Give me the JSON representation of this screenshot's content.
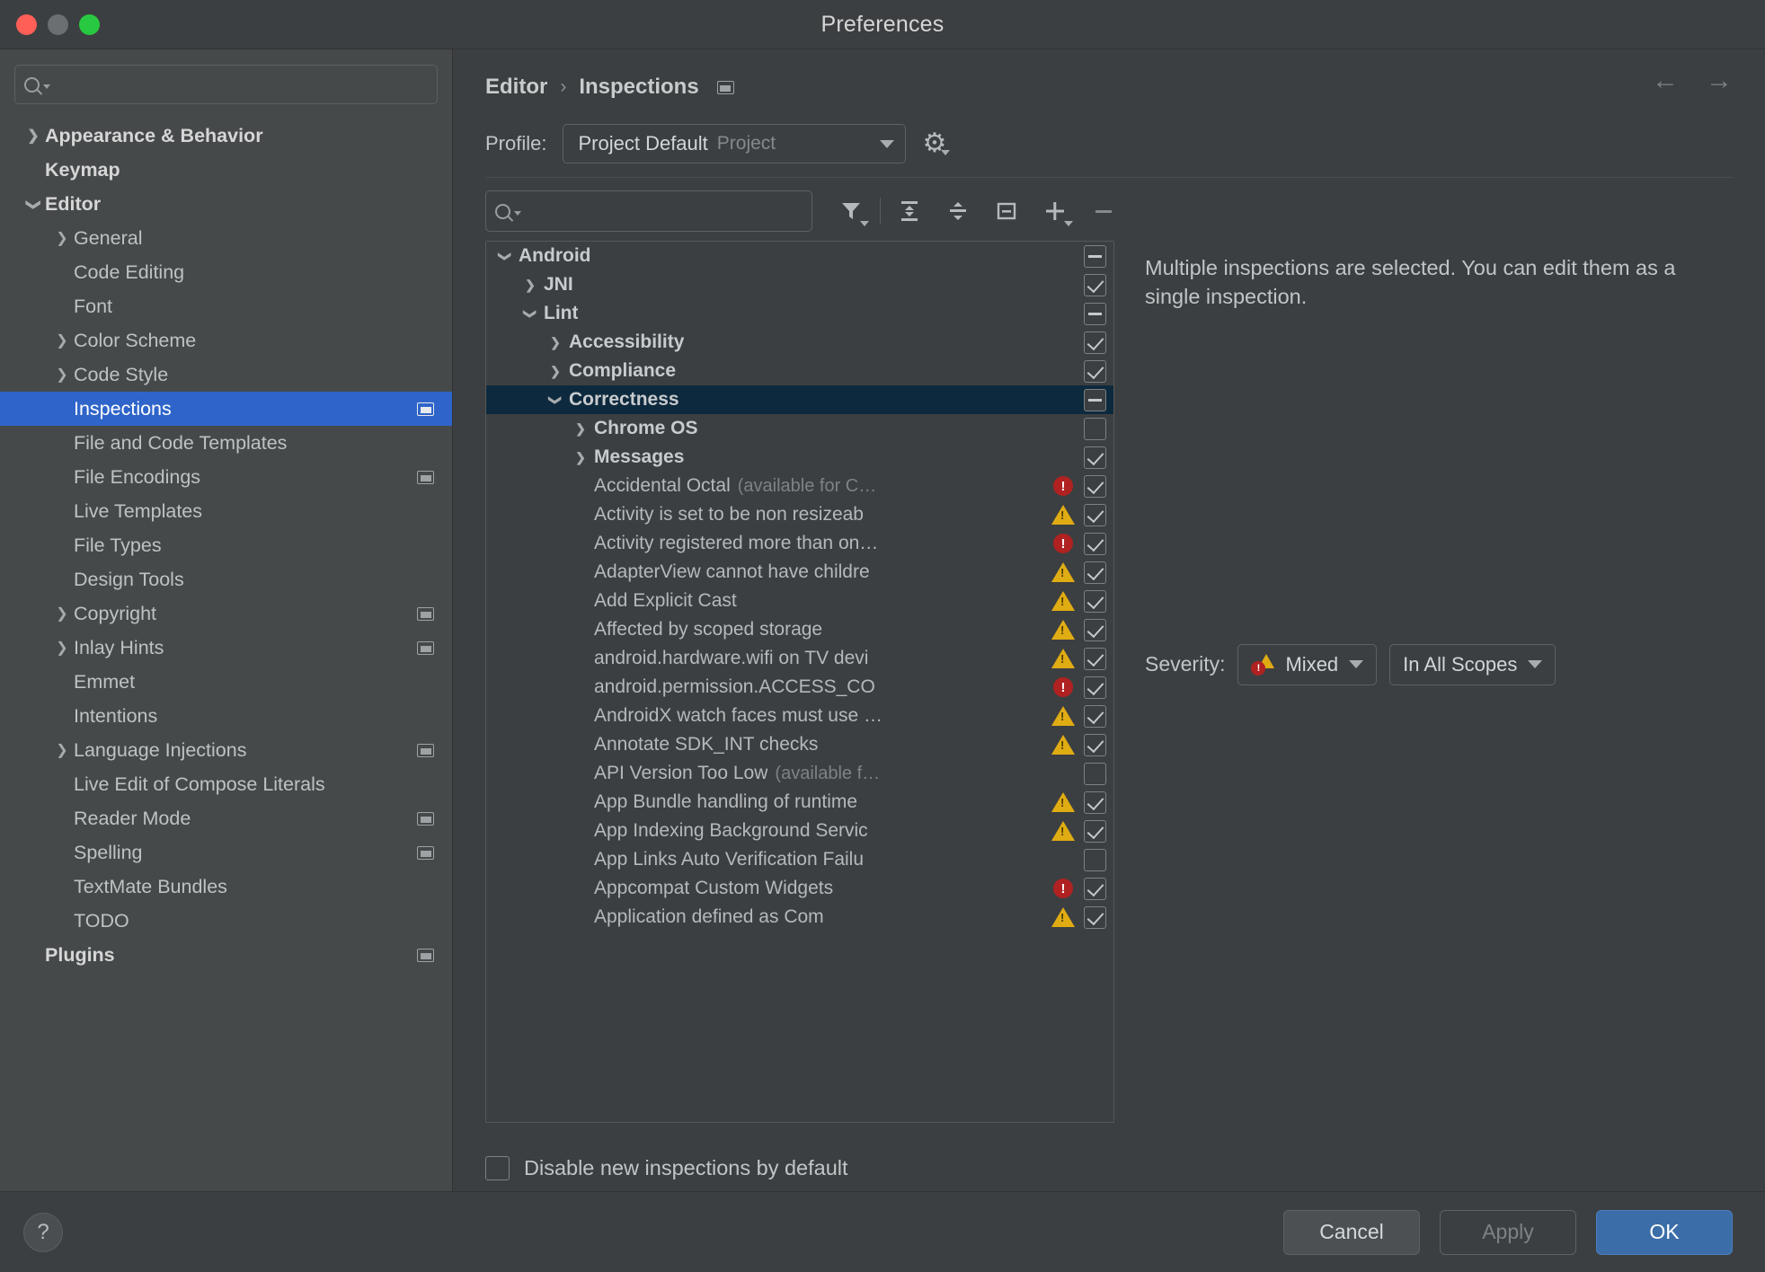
{
  "window": {
    "title": "Preferences",
    "traffic_lights": [
      "close",
      "minimize",
      "zoom"
    ]
  },
  "sidebar": {
    "search_placeholder": "",
    "search_value": "",
    "items": [
      {
        "label": "Appearance & Behavior",
        "chev": "r",
        "indent": 0,
        "bold": true,
        "badge": false,
        "selected": false
      },
      {
        "label": "Keymap",
        "chev": "none",
        "indent": 0,
        "bold": true,
        "badge": false,
        "selected": false
      },
      {
        "label": "Editor",
        "chev": "d",
        "indent": 0,
        "bold": true,
        "badge": false,
        "selected": false
      },
      {
        "label": "General",
        "chev": "r",
        "indent": 1,
        "bold": false,
        "badge": false,
        "selected": false
      },
      {
        "label": "Code Editing",
        "chev": "none",
        "indent": 1,
        "bold": false,
        "badge": false,
        "selected": false
      },
      {
        "label": "Font",
        "chev": "none",
        "indent": 1,
        "bold": false,
        "badge": false,
        "selected": false
      },
      {
        "label": "Color Scheme",
        "chev": "r",
        "indent": 1,
        "bold": false,
        "badge": false,
        "selected": false
      },
      {
        "label": "Code Style",
        "chev": "r",
        "indent": 1,
        "bold": false,
        "badge": false,
        "selected": false
      },
      {
        "label": "Inspections",
        "chev": "none",
        "indent": 1,
        "bold": false,
        "badge": true,
        "selected": true
      },
      {
        "label": "File and Code Templates",
        "chev": "none",
        "indent": 1,
        "bold": false,
        "badge": false,
        "selected": false
      },
      {
        "label": "File Encodings",
        "chev": "none",
        "indent": 1,
        "bold": false,
        "badge": true,
        "selected": false
      },
      {
        "label": "Live Templates",
        "chev": "none",
        "indent": 1,
        "bold": false,
        "badge": false,
        "selected": false
      },
      {
        "label": "File Types",
        "chev": "none",
        "indent": 1,
        "bold": false,
        "badge": false,
        "selected": false
      },
      {
        "label": "Design Tools",
        "chev": "none",
        "indent": 1,
        "bold": false,
        "badge": false,
        "selected": false
      },
      {
        "label": "Copyright",
        "chev": "r",
        "indent": 1,
        "bold": false,
        "badge": true,
        "selected": false
      },
      {
        "label": "Inlay Hints",
        "chev": "r",
        "indent": 1,
        "bold": false,
        "badge": true,
        "selected": false
      },
      {
        "label": "Emmet",
        "chev": "none",
        "indent": 1,
        "bold": false,
        "badge": false,
        "selected": false
      },
      {
        "label": "Intentions",
        "chev": "none",
        "indent": 1,
        "bold": false,
        "badge": false,
        "selected": false
      },
      {
        "label": "Language Injections",
        "chev": "r",
        "indent": 1,
        "bold": false,
        "badge": true,
        "selected": false
      },
      {
        "label": "Live Edit of Compose Literals",
        "chev": "none",
        "indent": 1,
        "bold": false,
        "badge": false,
        "selected": false
      },
      {
        "label": "Reader Mode",
        "chev": "none",
        "indent": 1,
        "bold": false,
        "badge": true,
        "selected": false
      },
      {
        "label": "Spelling",
        "chev": "none",
        "indent": 1,
        "bold": false,
        "badge": true,
        "selected": false
      },
      {
        "label": "TextMate Bundles",
        "chev": "none",
        "indent": 1,
        "bold": false,
        "badge": false,
        "selected": false
      },
      {
        "label": "TODO",
        "chev": "none",
        "indent": 1,
        "bold": false,
        "badge": false,
        "selected": false
      },
      {
        "label": "Plugins",
        "chev": "none",
        "indent": 0,
        "bold": true,
        "badge": true,
        "selected": false
      }
    ]
  },
  "main": {
    "breadcrumb": {
      "parent": "Editor",
      "separator": "›",
      "current": "Inspections"
    },
    "nav": {
      "back": "←",
      "forward": "→"
    },
    "profile": {
      "label": "Profile:",
      "value": "Project Default",
      "scope": "Project",
      "gear_icon": "gear-icon"
    },
    "filter_search_value": "",
    "toolbar_icons": [
      {
        "name": "filter-icon",
        "glyph": "▼"
      },
      {
        "name": "expand-all-icon",
        "glyph": ""
      },
      {
        "name": "collapse-all-icon",
        "glyph": ""
      },
      {
        "name": "show-only-enabled-icon",
        "glyph": ""
      },
      {
        "name": "add-icon",
        "glyph": "+"
      },
      {
        "name": "remove-icon",
        "glyph": "−"
      }
    ],
    "tree": [
      {
        "label": "Android",
        "note": "",
        "indent": 0,
        "chev": "d",
        "group": true,
        "check": "partial",
        "severity": "",
        "selected": false
      },
      {
        "label": "JNI",
        "note": "",
        "indent": 1,
        "chev": "r",
        "group": true,
        "check": "checked",
        "severity": "",
        "selected": false
      },
      {
        "label": "Lint",
        "note": "",
        "indent": 1,
        "chev": "d",
        "group": true,
        "check": "partial",
        "severity": "",
        "selected": false
      },
      {
        "label": "Accessibility",
        "note": "",
        "indent": 2,
        "chev": "r",
        "group": true,
        "check": "checked",
        "severity": "",
        "selected": false
      },
      {
        "label": "Compliance",
        "note": "",
        "indent": 2,
        "chev": "r",
        "group": true,
        "check": "checked",
        "severity": "",
        "selected": false
      },
      {
        "label": "Correctness",
        "note": "",
        "indent": 2,
        "chev": "d",
        "group": true,
        "check": "partial",
        "severity": "",
        "selected": true
      },
      {
        "label": "Chrome OS",
        "note": "",
        "indent": 3,
        "chev": "r",
        "group": true,
        "check": "none",
        "severity": "",
        "selected": false
      },
      {
        "label": "Messages",
        "note": "",
        "indent": 3,
        "chev": "r",
        "group": true,
        "check": "checked",
        "severity": "",
        "selected": false
      },
      {
        "label": "Accidental Octal",
        "note": "(available for C…",
        "indent": 3,
        "chev": "none",
        "group": false,
        "check": "checked",
        "severity": "error",
        "selected": false
      },
      {
        "label": "Activity is set to be non resizeab",
        "note": "",
        "indent": 3,
        "chev": "none",
        "group": false,
        "check": "checked",
        "severity": "warning",
        "selected": false
      },
      {
        "label": "Activity registered more than on…",
        "note": "",
        "indent": 3,
        "chev": "none",
        "group": false,
        "check": "checked",
        "severity": "error",
        "selected": false
      },
      {
        "label": "AdapterView cannot have childre",
        "note": "",
        "indent": 3,
        "chev": "none",
        "group": false,
        "check": "checked",
        "severity": "warning",
        "selected": false
      },
      {
        "label": "Add Explicit Cast",
        "note": "",
        "indent": 3,
        "chev": "none",
        "group": false,
        "check": "checked",
        "severity": "warning",
        "selected": false
      },
      {
        "label": "Affected by scoped storage",
        "note": "",
        "indent": 3,
        "chev": "none",
        "group": false,
        "check": "checked",
        "severity": "warning",
        "selected": false
      },
      {
        "label": "android.hardware.wifi on TV devi",
        "note": "",
        "indent": 3,
        "chev": "none",
        "group": false,
        "check": "checked",
        "severity": "warning",
        "selected": false
      },
      {
        "label": "android.permission.ACCESS_CO",
        "note": "",
        "indent": 3,
        "chev": "none",
        "group": false,
        "check": "checked",
        "severity": "error",
        "selected": false
      },
      {
        "label": "AndroidX watch faces must use …",
        "note": "",
        "indent": 3,
        "chev": "none",
        "group": false,
        "check": "checked",
        "severity": "warning",
        "selected": false
      },
      {
        "label": "Annotate SDK_INT checks",
        "note": "",
        "indent": 3,
        "chev": "none",
        "group": false,
        "check": "checked",
        "severity": "warning",
        "selected": false
      },
      {
        "label": "API Version Too Low",
        "note": "(available f…",
        "indent": 3,
        "chev": "none",
        "group": false,
        "check": "none",
        "severity": "",
        "selected": false
      },
      {
        "label": "App Bundle handling of runtime ",
        "note": "",
        "indent": 3,
        "chev": "none",
        "group": false,
        "check": "checked",
        "severity": "warning",
        "selected": false
      },
      {
        "label": "App Indexing Background Servic",
        "note": "",
        "indent": 3,
        "chev": "none",
        "group": false,
        "check": "checked",
        "severity": "warning",
        "selected": false
      },
      {
        "label": "App Links Auto Verification Failu",
        "note": "",
        "indent": 3,
        "chev": "none",
        "group": false,
        "check": "none",
        "severity": "",
        "selected": false
      },
      {
        "label": "Appcompat Custom Widgets",
        "note": "",
        "indent": 3,
        "chev": "none",
        "group": false,
        "check": "checked",
        "severity": "error",
        "selected": false
      },
      {
        "label": "Application defined as Com",
        "note": "",
        "indent": 3,
        "chev": "none",
        "group": false,
        "check": "checked",
        "severity": "warning",
        "selected": false
      }
    ],
    "detail": {
      "message": "Multiple inspections are selected. You can edit them as a single inspection.",
      "severity_label": "Severity:",
      "severity_value": "Mixed",
      "scope_value": "In All Scopes"
    },
    "disable_new_label": "Disable new inspections by default",
    "disable_new_checked": false
  },
  "footer": {
    "help_label": "?",
    "cancel_label": "Cancel",
    "apply_label": "Apply",
    "ok_label": "OK"
  },
  "colors": {
    "accent_blue": "#2f65ca",
    "primary_button": "#3b6ea8",
    "error_red": "#b02121",
    "warning_yellow": "#e0ac13",
    "selected_tree_row": "#0d293e",
    "sidebar_bg": "#45494a",
    "panel_bg": "#3c3f41"
  }
}
